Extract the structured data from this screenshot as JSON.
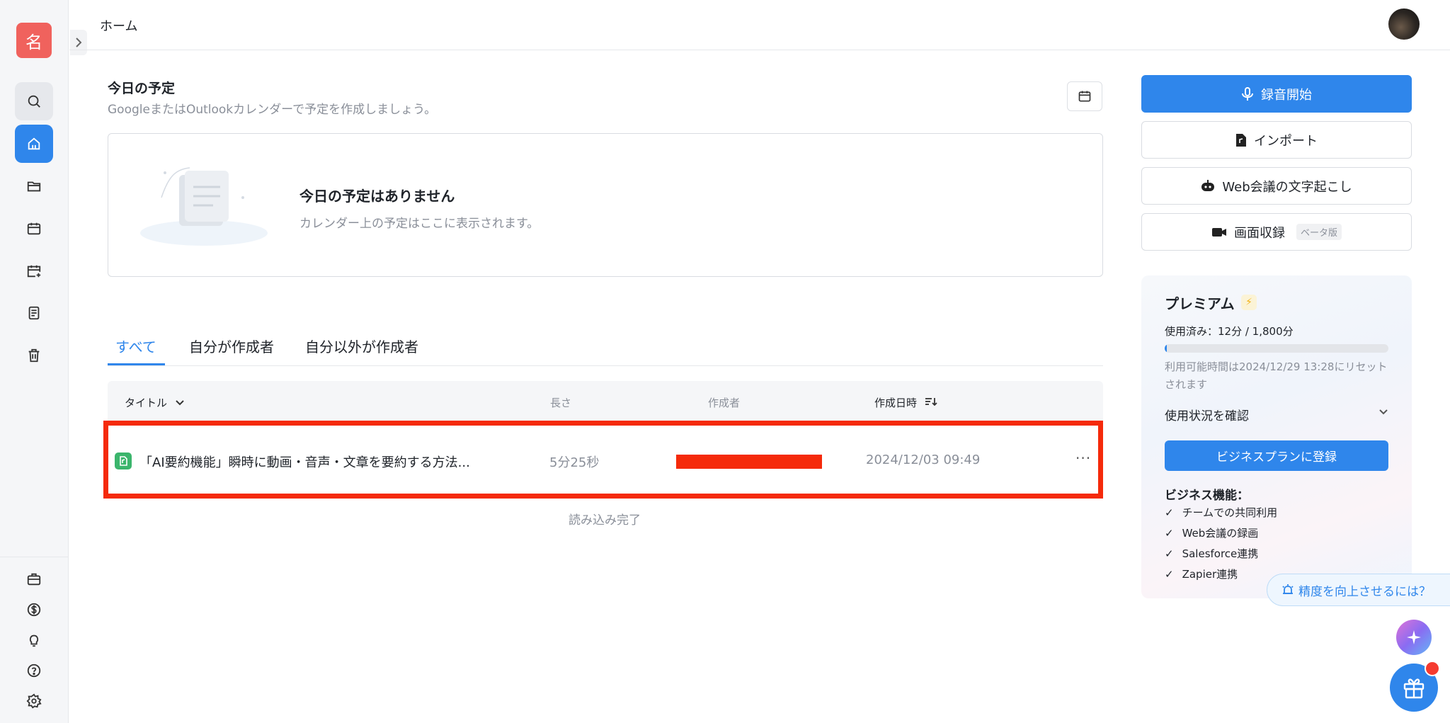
{
  "sidebar": {
    "logo_text": "名",
    "items": [
      {
        "name": "search-icon"
      },
      {
        "name": "home-icon"
      },
      {
        "name": "folder-icon"
      },
      {
        "name": "calendar-icon"
      },
      {
        "name": "calendar-add-icon"
      },
      {
        "name": "document-icon"
      },
      {
        "name": "trash-icon"
      }
    ],
    "bottom_items": [
      {
        "name": "briefcase-icon"
      },
      {
        "name": "dollar-icon"
      },
      {
        "name": "lightbulb-icon"
      },
      {
        "name": "help-icon"
      },
      {
        "name": "settings-icon"
      }
    ]
  },
  "header": {
    "title": "ホーム"
  },
  "schedule": {
    "title": "今日の予定",
    "subtitle": "GoogleまたはOutlookカレンダーで予定を作成しましょう。",
    "empty_title": "今日の予定はありません",
    "empty_subtitle": "カレンダー上の予定はここに表示されます。"
  },
  "tabs": [
    {
      "label": "すべて"
    },
    {
      "label": "自分が作成者"
    },
    {
      "label": "自分以外が作成者"
    }
  ],
  "table": {
    "columns": {
      "title": "タイトル",
      "length": "長さ",
      "author": "作成者",
      "created": "作成日時"
    },
    "rows": [
      {
        "title": "「AI要約機能」瞬時に動画・音声・文章を要約する方法...",
        "length": "5分25秒",
        "created": "2024/12/03 09:49"
      }
    ],
    "more_label": "···",
    "footer": "読み込み完了"
  },
  "actions": {
    "record": "録音開始",
    "import": "インポート",
    "web_meeting": "Web会議の文字起こし",
    "screen_record": "画面収録",
    "beta": "ベータ版"
  },
  "premium": {
    "title": "プレミアム",
    "bolt": "⚡",
    "usage": "使用済み：12分 / 1,800分",
    "usage_fraction": 0.0067,
    "reset_note": "利用可能時間は2024/12/29 13:28にリセットされます",
    "check_usage": "使用状況を確認",
    "upgrade_button": "ビジネスプランに登録",
    "features_title": "ビジネス機能：",
    "features": [
      "チームでの共同利用",
      "Web会議の録画",
      "Salesforce連携",
      "Zapier連携"
    ]
  },
  "tip": {
    "label": "精度を向上させるには？"
  },
  "colors": {
    "accent": "#2f86eb",
    "logo": "#f0625d",
    "highlight": "#f52a0a"
  }
}
